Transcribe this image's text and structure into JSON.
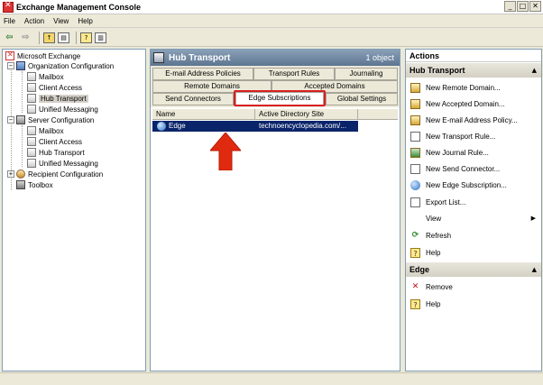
{
  "window": {
    "title": "Exchange Management Console",
    "buttons": [
      "_",
      "□",
      "✕"
    ]
  },
  "menu": [
    "File",
    "Action",
    "View",
    "Help"
  ],
  "toolbar": {
    "icons": [
      "back-arrow-icon",
      "forward-arrow-icon",
      "up-folder-icon",
      "show-hide-tree-icon",
      "help-icon",
      "show-hide-action-pane-icon"
    ]
  },
  "tree": {
    "root": "Microsoft Exchange",
    "org_config": "Organization Configuration",
    "org_items": [
      "Mailbox",
      "Client Access",
      "Hub Transport",
      "Unified Messaging"
    ],
    "server_config": "Server Configuration",
    "server_items": [
      "Mailbox",
      "Client Access",
      "Hub Transport",
      "Unified Messaging"
    ],
    "recipient_config": "Recipient Configuration",
    "toolbox": "Toolbox",
    "expander_minus": "−",
    "expander_plus": "+"
  },
  "center": {
    "title": "Hub Transport",
    "count": "1 object",
    "tabs_row1": [
      "E-mail Address Policies",
      "Transport Rules",
      "Journaling"
    ],
    "tabs_row2": [
      "Remote Domains",
      "Accepted Domains"
    ],
    "tabs_row3": [
      "Send Connectors",
      "Edge Subscriptions",
      "Global Settings"
    ],
    "active_tab": "Edge Subscriptions",
    "columns": [
      "Name",
      "Active Directory Site"
    ],
    "rows": [
      {
        "name": "Edge",
        "site": "technoencyclopedia.com/..."
      }
    ]
  },
  "actions": {
    "title": "Actions",
    "hub_section": "Hub Transport",
    "hub_items": [
      "New Remote Domain...",
      "New Accepted Domain...",
      "New E-mail Address Policy...",
      "New Transport Rule...",
      "New Journal Rule...",
      "New Send Connector...",
      "New Edge Subscription...",
      "Export List...",
      "View",
      "Refresh",
      "Help"
    ],
    "edge_section": "Edge",
    "edge_items": [
      "Remove",
      "Help"
    ],
    "caret": "▲",
    "submenu_arrow": "▶"
  },
  "colors": {
    "selection": "#0a246a",
    "highlight_box": "#d82020",
    "arrow": "#e02a10"
  }
}
